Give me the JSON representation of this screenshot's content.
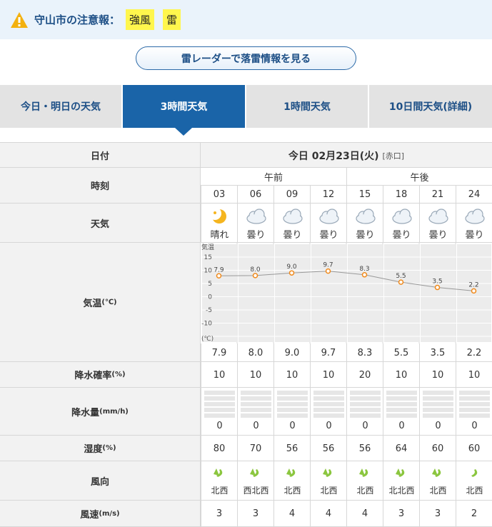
{
  "alert": {
    "label": "守山市の注意報：",
    "tags": [
      "強風",
      "雷"
    ]
  },
  "radar_button": "雷レーダーで落雷情報を見る",
  "tabs": [
    "今日・明日の天気",
    "3時間天気",
    "1時間天気",
    "10日間天気(詳細)"
  ],
  "active_tab": 1,
  "table": {
    "date_header": "日付",
    "date_value": "今日 02月23日(火)",
    "rokuyo": "[赤口]",
    "time_header": "時刻",
    "am_label": "午前",
    "pm_label": "午後",
    "hours": [
      "03",
      "06",
      "09",
      "12",
      "15",
      "18",
      "21",
      "24"
    ],
    "weather_header": "天気",
    "weather": [
      {
        "icon": "moon-sun-icon",
        "text": "晴れ"
      },
      {
        "icon": "cloud-icon",
        "text": "曇り"
      },
      {
        "icon": "cloud-icon",
        "text": "曇り"
      },
      {
        "icon": "cloud-icon",
        "text": "曇り"
      },
      {
        "icon": "cloud-icon",
        "text": "曇り"
      },
      {
        "icon": "cloud-icon",
        "text": "曇り"
      },
      {
        "icon": "cloud-icon",
        "text": "曇り"
      },
      {
        "icon": "cloud-icon",
        "text": "曇り"
      }
    ],
    "temp_header": "気温",
    "temp_unit": "(℃)",
    "temperatures": [
      "7.9",
      "8.0",
      "9.0",
      "9.7",
      "8.3",
      "5.5",
      "3.5",
      "2.2"
    ],
    "precip_prob_header": "降水確率",
    "precip_prob_unit": "(%)",
    "precip_prob": [
      "10",
      "10",
      "10",
      "10",
      "20",
      "10",
      "10",
      "10"
    ],
    "precip_amount_header": "降水量",
    "precip_amount_unit": "(mm/h)",
    "precip_amount": [
      "0",
      "0",
      "0",
      "0",
      "0",
      "0",
      "0",
      "0"
    ],
    "humidity_header": "湿度",
    "humidity_unit": "(%)",
    "humidity": [
      "80",
      "70",
      "56",
      "56",
      "56",
      "64",
      "60",
      "60"
    ],
    "wind_dir_header": "風向",
    "wind_dir": [
      "北西",
      "西北西",
      "北西",
      "北西",
      "北西",
      "北北西",
      "北西",
      "北西"
    ],
    "wind_speed_header": "風速",
    "wind_speed_unit": "(m/s)",
    "wind_speed": [
      "3",
      "3",
      "4",
      "4",
      "4",
      "3",
      "3",
      "2"
    ]
  },
  "chart_data": {
    "type": "line",
    "ylabel": "気温",
    "yunit": "(℃)",
    "ylim": [
      -15,
      15
    ],
    "yticks": [
      "15",
      "10",
      "5",
      "0",
      "-5",
      "-10"
    ],
    "categories": [
      "03",
      "06",
      "09",
      "12",
      "15",
      "18",
      "21",
      "24"
    ],
    "values": [
      7.9,
      8.0,
      9.0,
      9.7,
      8.3,
      5.5,
      3.5,
      2.2
    ],
    "point_color": "#f08a1c",
    "line_color": "#999999",
    "grid": true
  },
  "colors": {
    "accent": "#1a64a8",
    "alert_bg": "#eaf3fb",
    "tag_bg": "#fff64d",
    "wind_icon": "#8bc63f"
  }
}
